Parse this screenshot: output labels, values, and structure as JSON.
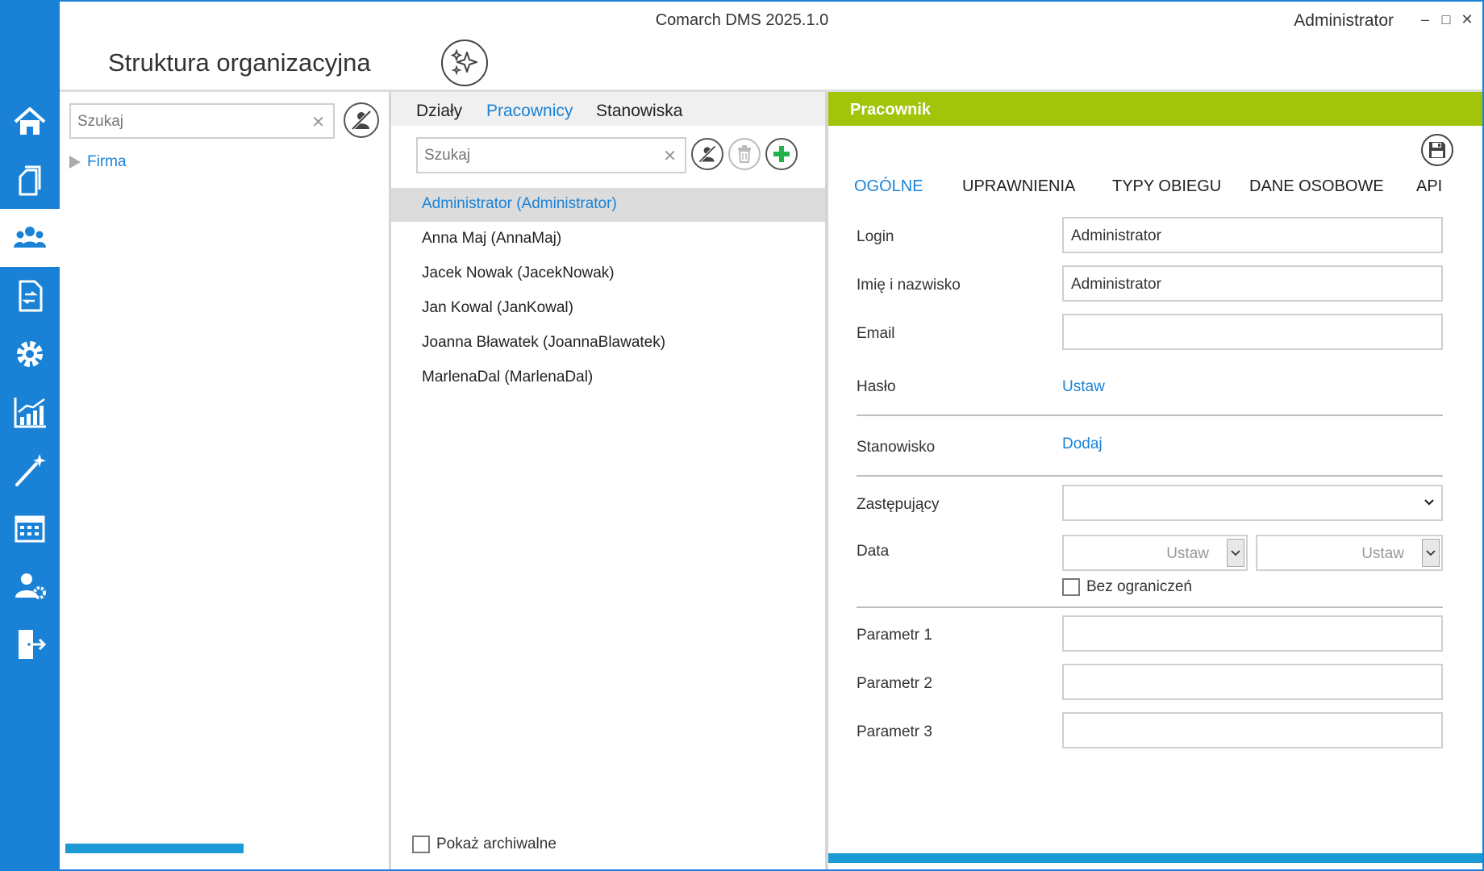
{
  "app": {
    "title": "Comarch DMS 2025.1.0",
    "user": "Administrator",
    "window_controls": {
      "minimize": "–",
      "maximize": "□",
      "close": "✕"
    }
  },
  "page": {
    "title": "Struktura organizacyjna"
  },
  "rail": {
    "items": [
      {
        "name": "home-icon",
        "active": false
      },
      {
        "name": "documents-icon",
        "active": false
      },
      {
        "name": "users-icon",
        "active": true
      },
      {
        "name": "workflow-document-icon",
        "active": false
      },
      {
        "name": "settings-gear-icon",
        "active": false
      },
      {
        "name": "reports-chart-icon",
        "active": false
      },
      {
        "name": "magic-wand-icon",
        "active": false
      },
      {
        "name": "calendar-icon",
        "active": false
      },
      {
        "name": "user-settings-icon",
        "active": false
      },
      {
        "name": "logout-door-icon",
        "active": false
      }
    ],
    "accent": "#1a82d6"
  },
  "tree": {
    "search_placeholder": "Szukaj",
    "clear": "✕",
    "nodes": [
      {
        "label": "Firma"
      }
    ]
  },
  "list": {
    "tabs": [
      {
        "label": "Działy",
        "active": false
      },
      {
        "label": "Pracownicy",
        "active": true
      },
      {
        "label": "Stanowiska",
        "active": false
      }
    ],
    "search_placeholder": "Szukaj",
    "clear": "✕",
    "employees": [
      {
        "label": "Administrator (Administrator)",
        "selected": true
      },
      {
        "label": "Anna Maj (AnnaMaj)",
        "selected": false
      },
      {
        "label": "Jacek Nowak (JacekNowak)",
        "selected": false
      },
      {
        "label": "Jan Kowal (JanKowal)",
        "selected": false
      },
      {
        "label": "Joanna Bławatek (JoannaBlawatek)",
        "selected": false
      },
      {
        "label": "MarlenaDal (MarlenaDal)",
        "selected": false
      }
    ],
    "show_archived_label": "Pokaż archiwalne"
  },
  "detail": {
    "header": "Pracownik",
    "header_color": "#a2c40a",
    "tabs": [
      {
        "label": "OGÓLNE",
        "active": true
      },
      {
        "label": "UPRAWNIENIA",
        "active": false
      },
      {
        "label": "TYPY OBIEGU",
        "active": false
      },
      {
        "label": "DANE OSOBOWE",
        "active": false
      },
      {
        "label": "API",
        "active": false
      }
    ],
    "login": {
      "label": "Login",
      "value": "Administrator"
    },
    "full_name": {
      "label": "Imię i nazwisko",
      "value": "Administrator"
    },
    "email": {
      "label": "Email",
      "value": ""
    },
    "password": {
      "label": "Hasło",
      "link": "Ustaw"
    },
    "position": {
      "label": "Stanowisko",
      "link": "Dodaj"
    },
    "substitute": {
      "label": "Zastępujący",
      "value": ""
    },
    "date": {
      "label": "Data",
      "from_placeholder": "Ustaw",
      "to_placeholder": "Ustaw"
    },
    "unlimited": {
      "label": "Bez ograniczeń"
    },
    "param1": {
      "label": "Parametr 1",
      "value": ""
    },
    "param2": {
      "label": "Parametr 2",
      "value": ""
    },
    "param3": {
      "label": "Parametr 3",
      "value": ""
    }
  }
}
